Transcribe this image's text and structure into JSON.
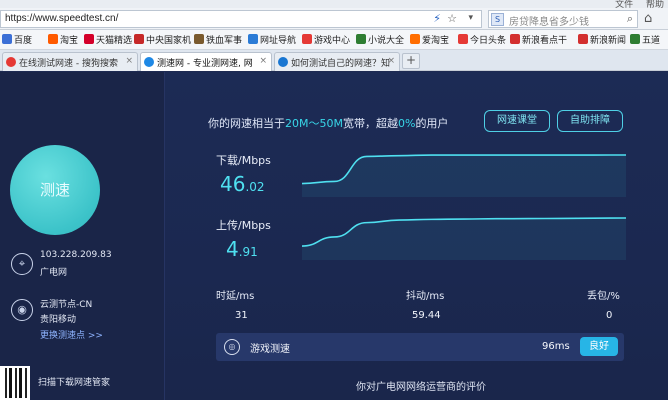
{
  "browser": {
    "menu": [
      "文件",
      "帮助"
    ],
    "url": "https://www.speedtest.cn/",
    "search_engine_label": "S",
    "search_text": "房贷降息省多少钱",
    "bookmarks": [
      {
        "label": "百度",
        "color": "#3b6fd6"
      },
      {
        "label": "淘宝",
        "color": "#ff5a00"
      },
      {
        "label": "天猫精选",
        "color": "#d4002a"
      },
      {
        "label": "中央国家机",
        "color": "#c62828"
      },
      {
        "label": "铁血军事",
        "color": "#7a5a2e"
      },
      {
        "label": "网址导航",
        "color": "#2b7bd6"
      },
      {
        "label": "游戏中心",
        "color": "#e53935"
      },
      {
        "label": "小说大全",
        "color": "#2e7d32"
      },
      {
        "label": "爱淘宝",
        "color": "#ff6d00"
      },
      {
        "label": "今日头条",
        "color": "#e53935"
      },
      {
        "label": "新浪看点干",
        "color": "#d32f2f"
      },
      {
        "label": "新浪新闻",
        "color": "#d32f2f"
      },
      {
        "label": "五道",
        "color": "#2e7d32"
      }
    ],
    "tabs": [
      {
        "label": "在线测试网速 - 搜狗搜索",
        "active": false,
        "color": "#e53935"
      },
      {
        "label": "测速网 - 专业测网速, 网",
        "active": true,
        "color": "#1e88e5"
      },
      {
        "label": "如何测试自己的网速？知",
        "active": false,
        "color": "#1976d2"
      }
    ],
    "new_tab": "+"
  },
  "sidebar": {
    "start_label": "测速",
    "ip": "103.228.209.83",
    "isp": "广电网",
    "node_title": "云测节点-CN",
    "node_name": "贵阳移动",
    "change_node": "更换测速点 >>",
    "download_app": "扫描下载网速管家"
  },
  "result": {
    "headline_prefix": "你的网速相当于",
    "headline_band": "20M～50M",
    "headline_mid": "宽带，超越",
    "headline_pct": "0%",
    "headline_suffix": "的用户",
    "btn_class": "网速课堂",
    "btn_rank": "自助排障",
    "download_label": "下载/Mbps",
    "download_int": "46",
    "download_dec": ".02",
    "upload_label": "上传/Mbps",
    "upload_int": "4",
    "upload_dec": ".91",
    "latency_label": "时延/ms",
    "latency_value": "31",
    "jitter_label": "抖动/ms",
    "jitter_value": "59.44",
    "loss_label": "丢包/%",
    "loss_value": "0",
    "game_label": "游戏测速",
    "game_value": "96ms",
    "game_rating": "良好",
    "eval_text": "你对广电网网络运营商的评价"
  },
  "chart_data": [
    {
      "type": "line",
      "title": "下载/Mbps",
      "x": [
        0,
        1,
        2,
        3,
        4,
        5,
        6,
        7,
        8,
        9,
        10
      ],
      "y": [
        5,
        8,
        44,
        45,
        46,
        46,
        46,
        46,
        46,
        46,
        46.02
      ]
    },
    {
      "type": "line",
      "title": "上传/Mbps",
      "x": [
        0,
        1,
        2,
        3,
        4,
        5,
        6,
        7,
        8,
        9,
        10
      ],
      "y": [
        0.6,
        2.0,
        4.2,
        4.6,
        4.7,
        4.75,
        4.8,
        4.82,
        4.85,
        4.88,
        4.91
      ]
    }
  ],
  "colors": {
    "accent": "#4fe0f0",
    "highlight": "#38d6e8",
    "rating_button": "#27b5e6"
  }
}
